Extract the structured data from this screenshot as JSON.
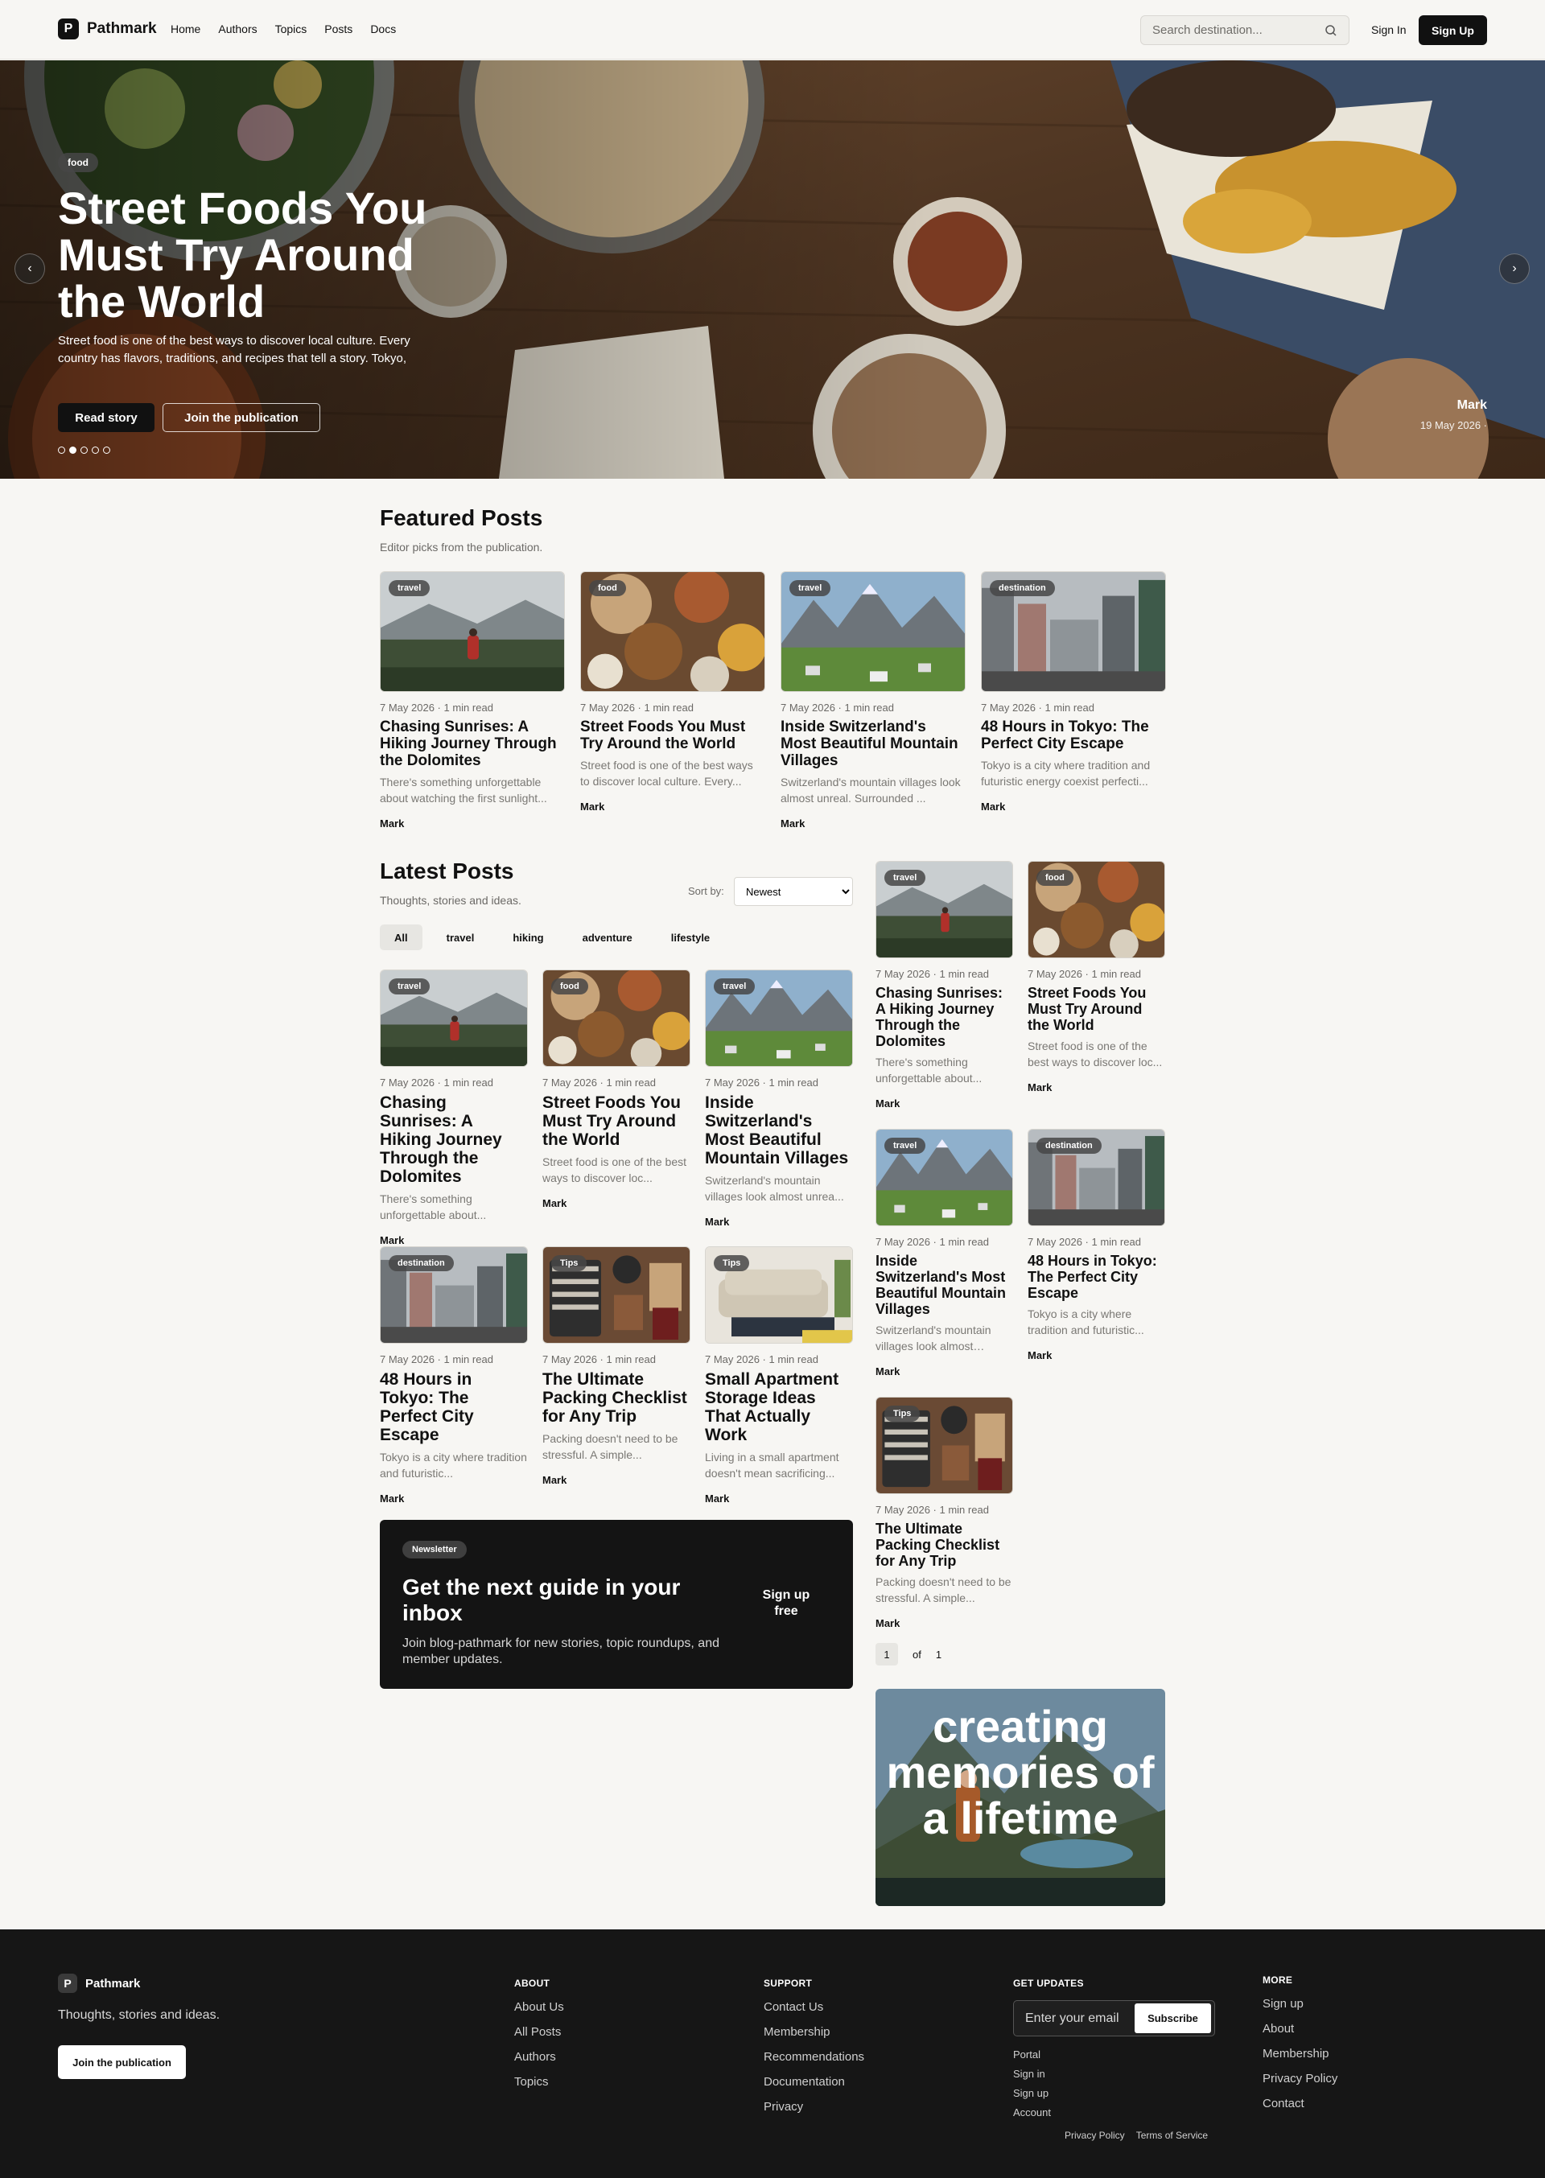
{
  "header": {
    "logo_letter": "P",
    "brand": "Pathmark",
    "nav": [
      "Home",
      "Authors",
      "Topics",
      "Posts",
      "Docs"
    ],
    "search_placeholder": "Search destination...",
    "signin": "Sign In",
    "signup": "Sign Up"
  },
  "hero": {
    "tag": "food",
    "title": "Street Foods You Must Try Around the World",
    "excerpt": "Street food is one of the best ways to discover local culture. Every country has flavors, traditions, and recipes that tell a story. Tokyo,",
    "read_btn": "Read story",
    "join_btn": "Join the publication",
    "author": "Mark",
    "date": "19 May 2026 ·",
    "prev": "‹",
    "next": "›"
  },
  "featured": {
    "title": "Featured Posts",
    "subtitle": "Editor picks from the publication.",
    "posts": [
      {
        "tag": "travel",
        "date": "7 May 2026",
        "read": "1 min read",
        "title": "Chasing Sunrises: A Hiking Journey Through the Dolomites",
        "excerpt": "There's something unforgettable about watching the first sunlight...",
        "author": "Mark",
        "image": "hiker"
      },
      {
        "tag": "food",
        "date": "7 May 2026",
        "read": "1 min read",
        "title": "Street Foods You Must Try Around the World",
        "excerpt": "Street food is one of the best ways to discover local culture. Every...",
        "author": "Mark",
        "image": "food"
      },
      {
        "tag": "travel",
        "date": "7 May 2026",
        "read": "1 min read",
        "title": "Inside Switzerland's Most Beautiful Mountain Villages",
        "excerpt": "Switzerland's mountain villages look almost unreal. Surrounded ...",
        "author": "Mark",
        "image": "mountain"
      },
      {
        "tag": "destination",
        "date": "7 May 2026",
        "read": "1 min read",
        "title": "48 Hours in Tokyo: The Perfect City Escape",
        "excerpt": "Tokyo is a city where tradition and futuristic energy coexist perfecti...",
        "author": "Mark",
        "image": "city"
      }
    ]
  },
  "latest": {
    "title": "Latest Posts",
    "subtitle": "Thoughts, stories and ideas.",
    "sort_label": "Sort by:",
    "sort_value": "Newest",
    "filters": [
      "All",
      "travel",
      "hiking",
      "adventure",
      "lifestyle"
    ],
    "posts": [
      {
        "tag": "travel",
        "date": "7 May 2026",
        "read": "1 min read",
        "title": "Chasing Sunrises: A Hiking Journey Through the Dolomites",
        "excerpt": "There's something unforgettable about...",
        "author": "Mark",
        "image": "hiker"
      },
      {
        "tag": "food",
        "date": "7 May 2026",
        "read": "1 min read",
        "title": "Street Foods You Must Try Around the World",
        "excerpt": "Street food is one of the best ways to discover loc...",
        "author": "Mark",
        "image": "food"
      },
      {
        "tag": "travel",
        "date": "7 May 2026",
        "read": "1 min read",
        "title": "Inside Switzerland's Most Beautiful Mountain Villages",
        "excerpt": "Switzerland's mountain villages look almost unrea...",
        "author": "Mark",
        "image": "mountain"
      },
      {
        "tag": "destination",
        "date": "7 May 2026",
        "read": "1 min read",
        "title": "48 Hours in Tokyo: The Perfect City Escape",
        "excerpt": "Tokyo is a city where tradition and futuristic...",
        "author": "Mark",
        "image": "city"
      },
      {
        "tag": "Tips",
        "date": "7 May 2026",
        "read": "1 min read",
        "title": "The Ultimate Packing Checklist for Any Trip",
        "excerpt": "Packing doesn't need to be stressful. A simple...",
        "author": "Mark",
        "image": "packing"
      },
      {
        "tag": "Tips",
        "date": "7 May 2026",
        "read": "1 min read",
        "title": "Small Apartment Storage Ideas That Actually Work",
        "excerpt": "Living in a small apartment doesn't mean sacrificing...",
        "author": "Mark",
        "image": "sofa"
      }
    ]
  },
  "side": {
    "posts": [
      {
        "tag": "travel",
        "date": "7 May 2026",
        "read": "1 min read",
        "title": "Chasing Sunrises: A Hiking Journey Through the Dolomites",
        "excerpt": "There's something unforgettable about...",
        "author": "Mark",
        "image": "hiker"
      },
      {
        "tag": "food",
        "date": "7 May 2026",
        "read": "1 min read",
        "title": "Street Foods You Must Try Around the World",
        "excerpt": "Street food is one of the best ways to discover loc...",
        "author": "Mark",
        "image": "food"
      },
      {
        "tag": "travel",
        "date": "7 May 2026",
        "read": "1 min read",
        "title": "Inside Switzerland's Most Beautiful Mountain Villages",
        "excerpt": "Switzerland's mountain villages look almost unrea...",
        "author": "Mark",
        "image": "mountain"
      },
      {
        "tag": "destination",
        "date": "7 May 2026",
        "read": "1 min read",
        "title": "48 Hours in Tokyo: The Perfect City Escape",
        "excerpt": "Tokyo is a city where tradition and futuristic...",
        "author": "Mark",
        "image": "city"
      },
      {
        "tag": "Tips",
        "date": "7 May 2026",
        "read": "1 min read",
        "title": "The Ultimate Packing Checklist for Any Trip",
        "excerpt": "Packing doesn't need to be stressful. A simple...",
        "author": "Mark",
        "image": "packing"
      }
    ],
    "page_current": "1",
    "page_of": "of",
    "page_total": "1",
    "promo_text": "creating memories of a lifetime"
  },
  "newsletter": {
    "tag": "Newsletter",
    "title": "Get the next guide in your inbox",
    "text": "Join blog-pathmark for new stories, topic roundups, and member updates.",
    "button": "Sign up free"
  },
  "footer": {
    "brand": "Pathmark",
    "logo_letter": "P",
    "tagline": "Thoughts, stories and ideas.",
    "join": "Join the publication",
    "about": {
      "title": "ABOUT",
      "links": [
        "About Us",
        "All Posts",
        "Authors",
        "Topics"
      ]
    },
    "support": {
      "title": "SUPPORT",
      "links": [
        "Contact Us",
        "Membership",
        "Recommendations",
        "Documentation",
        "Privacy"
      ]
    },
    "updates": {
      "title": "GET UPDATES",
      "email_placeholder": "Enter your email",
      "subscribe": "Subscribe",
      "links": [
        "Portal",
        "Sign in",
        "Sign up",
        "Account"
      ]
    },
    "more": {
      "title": "MORE",
      "links": [
        "Sign up",
        "About",
        "Membership",
        "Privacy Policy",
        "Contact"
      ]
    },
    "legal": [
      "Privacy Policy",
      "Terms of Service"
    ]
  },
  "colors": {
    "accent": "#111111",
    "background": "#f7f6f3",
    "footer": "#161616"
  }
}
